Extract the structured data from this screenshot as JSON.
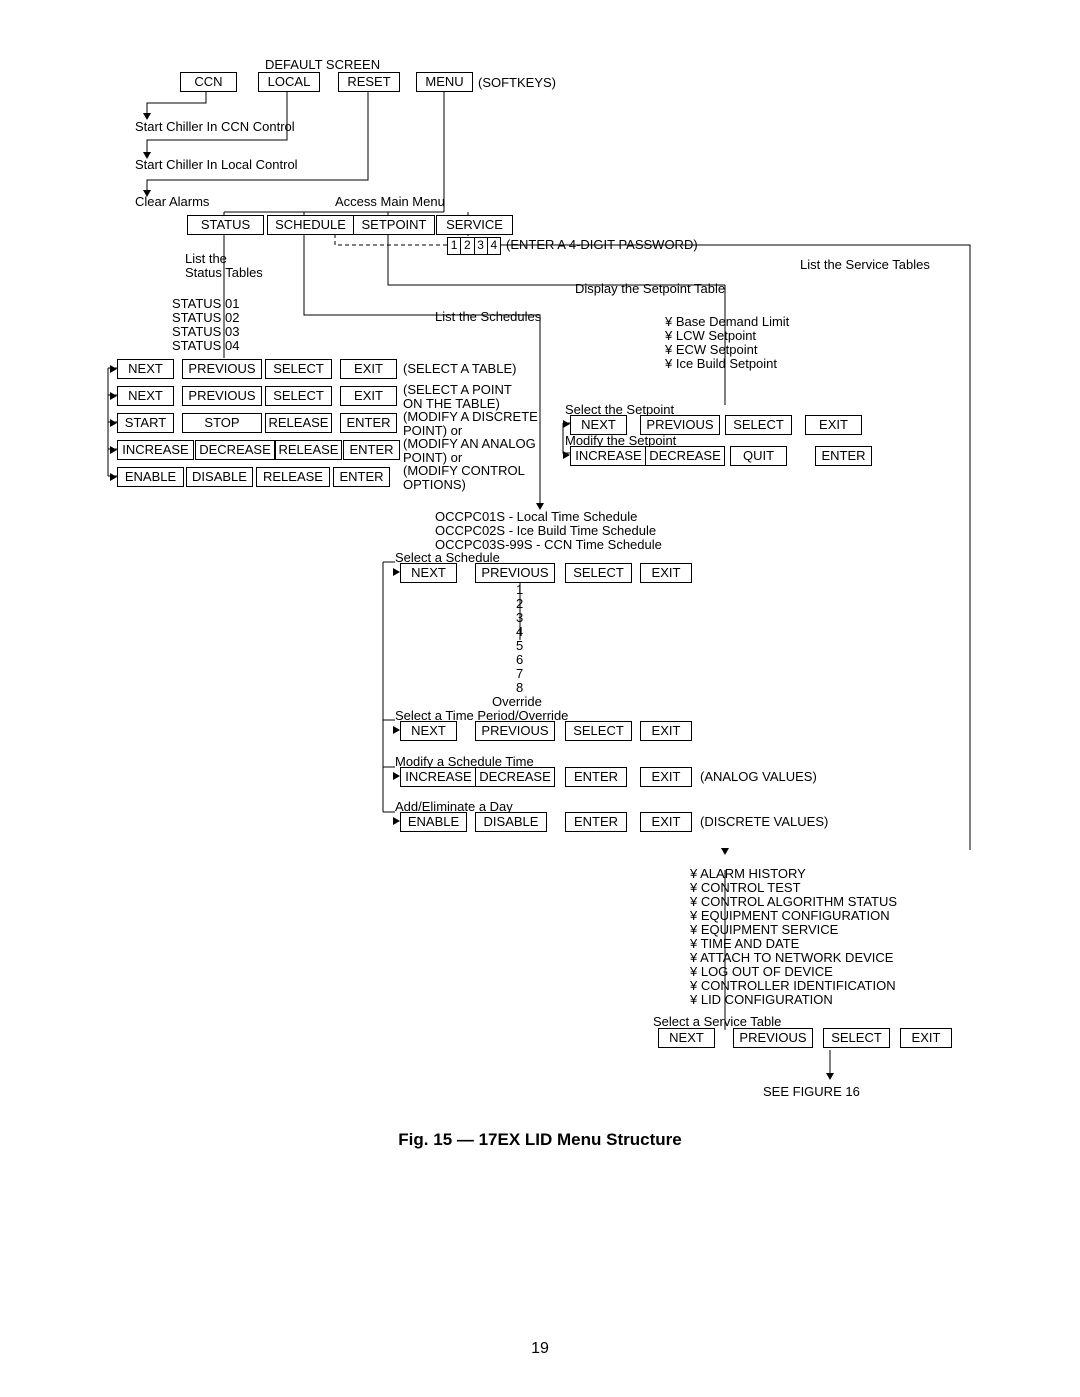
{
  "header": {
    "default_screen": "DEFAULT SCREEN",
    "softkeys": "(SOFTKEYS)"
  },
  "top": {
    "ccn": "CCN",
    "local": "LOCAL",
    "reset": "RESET",
    "menu": "MENU"
  },
  "labels": {
    "start_ccn": "Start Chiller In CCN Control",
    "start_local": "Start Chiller In Local Control",
    "clear_alarms": "Clear Alarms",
    "access_main": "Access Main Menu"
  },
  "main": {
    "status": "STATUS",
    "schedule": "SCHEDULE",
    "setpoint": "SETPOINT",
    "service": "SERVICE"
  },
  "password": {
    "digits": [
      "1",
      "2",
      "3",
      "4"
    ],
    "hint": "(ENTER A 4-DIGIT PASSWORD)"
  },
  "status": {
    "list_label": "List the\nStatus Tables",
    "items": [
      "STATUS 01",
      "STATUS 02",
      "STATUS 03",
      "STATUS 04"
    ],
    "rows": [
      {
        "cols": [
          "NEXT",
          "PREVIOUS",
          "SELECT",
          "EXIT"
        ],
        "note": "(SELECT A TABLE)"
      },
      {
        "cols": [
          "NEXT",
          "PREVIOUS",
          "SELECT",
          "EXIT"
        ],
        "note": "(SELECT A POINT ON THE TABLE)"
      },
      {
        "cols": [
          "START",
          "STOP",
          "RELEASE",
          "ENTER"
        ],
        "note": "(MODIFY A DISCRETE POINT) or"
      },
      {
        "cols": [
          "INCREASE",
          "DECREASE",
          "RELEASE",
          "ENTER"
        ],
        "note": "(MODIFY AN ANALOG POINT) or"
      },
      {
        "cols": [
          "ENABLE",
          "DISABLE",
          "RELEASE",
          "ENTER"
        ],
        "note": "(MODIFY CONTROL OPTIONS)"
      }
    ]
  },
  "setpoint": {
    "display": "Display the Setpoint Table",
    "items": [
      "¥ Base Demand Limit",
      "¥ LCW Setpoint",
      "¥ ECW Setpoint",
      "¥ Ice Build Setpoint"
    ],
    "select": "Select the Setpoint",
    "row1": [
      "NEXT",
      "PREVIOUS",
      "SELECT",
      "EXIT"
    ],
    "modify": "Modify the Setpoint",
    "row2": [
      "INCREASE",
      "DECREASE",
      "QUIT",
      "ENTER"
    ]
  },
  "schedule": {
    "list": "List the Schedules",
    "lines": [
      "OCCPC01S - Local Time Schedule",
      "OCCPC02S - Ice Build Time Schedule",
      "OCCPC03S-99S - CCN Time Schedule"
    ],
    "select": "Select a Schedule",
    "row1": [
      "NEXT",
      "PREVIOUS",
      "SELECT",
      "EXIT"
    ],
    "periods": [
      "1",
      "2",
      "3",
      "4",
      "5",
      "6",
      "7",
      "8",
      "Override"
    ],
    "select_period": "Select a Time Period/Override",
    "row2": [
      "NEXT",
      "PREVIOUS",
      "SELECT",
      "EXIT"
    ],
    "modify_time": "Modify a Schedule Time",
    "row3": [
      "INCREASE",
      "DECREASE",
      "ENTER",
      "EXIT"
    ],
    "row3_note": "(ANALOG VALUES)",
    "add_day": "Add/Eliminate a Day",
    "row4": [
      "ENABLE",
      "DISABLE",
      "ENTER",
      "EXIT"
    ],
    "row4_note": "(DISCRETE VALUES)"
  },
  "service": {
    "list": "List the Service Tables",
    "items": [
      "¥ ALARM HISTORY",
      "¥ CONTROL TEST",
      "¥ CONTROL ALGORITHM STATUS",
      "¥ EQUIPMENT CONFIGURATION",
      "¥ EQUIPMENT SERVICE",
      "¥ TIME AND DATE",
      "¥ ATTACH TO NETWORK DEVICE",
      "¥ LOG OUT OF DEVICE",
      "¥ CONTROLLER IDENTIFICATION",
      "¥ LID CONFIGURATION"
    ],
    "select": "Select a Service Table",
    "row": [
      "NEXT",
      "PREVIOUS",
      "SELECT",
      "EXIT"
    ],
    "see": "SEE FIGURE 16"
  },
  "caption": "Fig. 15 — 17EX LID Menu Structure",
  "pagenum": "19"
}
